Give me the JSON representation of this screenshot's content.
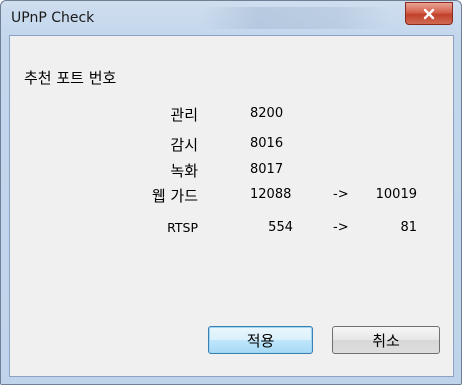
{
  "window": {
    "title": "UPnP Check"
  },
  "section": {
    "title": "추천 포트 번호"
  },
  "rows": [
    {
      "label": "관리",
      "value": "8200",
      "arrow": "",
      "mapped": ""
    },
    {
      "label": "감시",
      "value": "8016",
      "arrow": "",
      "mapped": ""
    },
    {
      "label": "녹화",
      "value": "8017",
      "arrow": "",
      "mapped": ""
    },
    {
      "label": "웹 가드",
      "value": "12088",
      "arrow": "->",
      "mapped": "10019"
    },
    {
      "label": "RTSP",
      "value": "554",
      "arrow": "->",
      "mapped": "81"
    }
  ],
  "buttons": {
    "apply": "적용",
    "cancel": "취소"
  },
  "icons": {
    "close": "close-icon"
  },
  "colors": {
    "close_button": "#c1412c",
    "primary_button_border": "#3c7fb1",
    "frame": "#c2d6ec"
  }
}
